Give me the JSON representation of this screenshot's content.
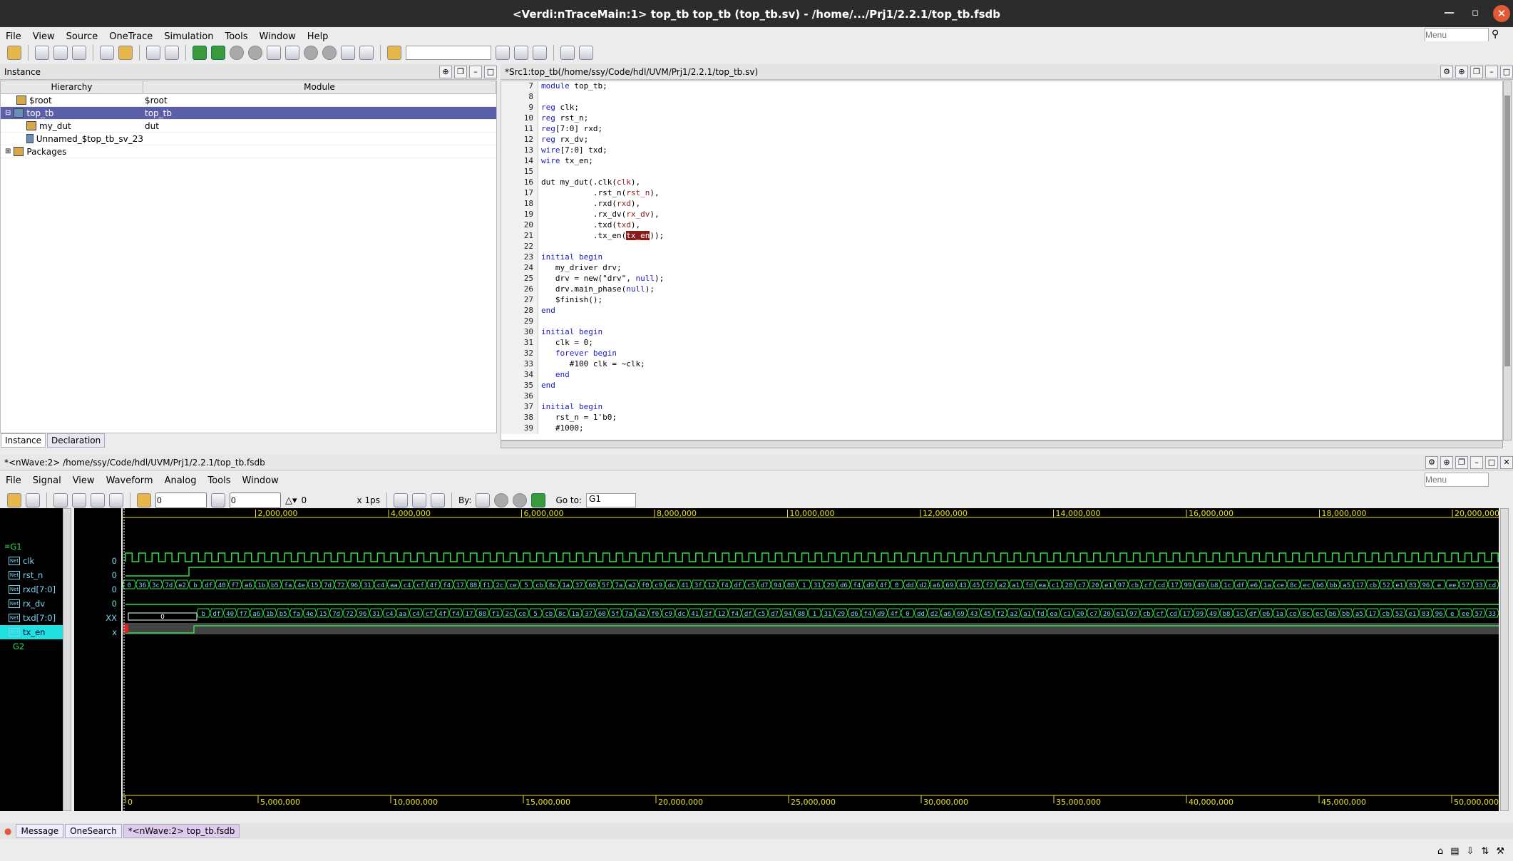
{
  "window": {
    "title": "<Verdi:nTraceMain:1> top_tb top_tb (top_tb.sv) - /home/.../Prj1/2.2.1/top_tb.fsdb"
  },
  "menu": [
    "File",
    "View",
    "Source",
    "OneTrace",
    "Simulation",
    "Tools",
    "Window",
    "Help"
  ],
  "menu_search_placeholder": "Menu",
  "instance_panel": {
    "title": "Instance",
    "col_hier": "Hierarchy",
    "col_module": "Module",
    "rows": [
      {
        "name": "$root",
        "module": "$root"
      },
      {
        "name": "top_tb",
        "module": "top_tb"
      },
      {
        "name": "my_dut",
        "module": "dut"
      },
      {
        "name": "Unnamed_$top_tb_sv_23",
        "module": ""
      },
      {
        "name": "Packages",
        "module": ""
      }
    ],
    "tabs": [
      "Instance",
      "Declaration"
    ]
  },
  "source": {
    "title": "*Src1:top_tb(/home/ssy/Code/hdl/UVM/Prj1/2.2.1/top_tb.sv)",
    "lines": [
      [
        "7",
        "module top_tb;"
      ],
      [
        "8",
        ""
      ],
      [
        "9",
        "reg clk;"
      ],
      [
        "10",
        "reg rst_n;"
      ],
      [
        "11",
        "reg[7:0] rxd;"
      ],
      [
        "12",
        "reg rx_dv;"
      ],
      [
        "13",
        "wire[7:0] txd;"
      ],
      [
        "14",
        "wire tx_en;"
      ],
      [
        "15",
        ""
      ],
      [
        "16",
        "dut my_dut(.clk(clk),"
      ],
      [
        "17",
        "           .rst_n(rst_n),"
      ],
      [
        "18",
        "           .rxd(rxd),"
      ],
      [
        "19",
        "           .rx_dv(rx_dv),"
      ],
      [
        "20",
        "           .txd(txd),"
      ],
      [
        "21",
        "           .tx_en(tx_en));"
      ],
      [
        "22",
        ""
      ],
      [
        "23",
        "initial begin"
      ],
      [
        "24",
        "   my_driver drv;"
      ],
      [
        "25",
        "   drv = new(\"drv\", null);"
      ],
      [
        "26",
        "   drv.main_phase(null);"
      ],
      [
        "27",
        "   $finish();"
      ],
      [
        "28",
        "end"
      ],
      [
        "29",
        ""
      ],
      [
        "30",
        "initial begin"
      ],
      [
        "31",
        "   clk = 0;"
      ],
      [
        "32",
        "   forever begin"
      ],
      [
        "33",
        "      #100 clk = ~clk;"
      ],
      [
        "34",
        "   end"
      ],
      [
        "35",
        "end"
      ],
      [
        "36",
        ""
      ],
      [
        "37",
        "initial begin"
      ],
      [
        "38",
        "   rst_n = 1'b0;"
      ],
      [
        "39",
        "   #1000;"
      ]
    ]
  },
  "wave": {
    "title": "*<nWave:2> /home/ssy/Code/hdl/UVM/Prj1/2.2.1/top_tb.fsdb",
    "menu": [
      "File",
      "Signal",
      "View",
      "Waveform",
      "Analog",
      "Tools",
      "Window"
    ],
    "cursor": "0",
    "marker": "0",
    "delta": "0",
    "unit": "x 1ps",
    "by_label": "By:",
    "goto_label": "Go to:",
    "goto_value": "G1",
    "top_ticks": [
      "2,000,000",
      "4,000,000",
      "6,000,000",
      "8,000,000",
      "10,000,000",
      "12,000,000",
      "14,000,000",
      "16,000,000",
      "18,000,000",
      "20,000,000"
    ],
    "bottom_ticks": [
      "0",
      "5,000,000",
      "10,000,000",
      "15,000,000",
      "20,000,000",
      "25,000,000",
      "30,000,000",
      "35,000,000",
      "40,000,000",
      "45,000,000",
      "50,000,000"
    ],
    "groups": [
      "G1",
      "G2"
    ],
    "signals": [
      {
        "name": "clk",
        "value": "0"
      },
      {
        "name": "rst_n",
        "value": "0"
      },
      {
        "name": "rxd[7:0]",
        "value": "0"
      },
      {
        "name": "rx_dv",
        "value": "0"
      },
      {
        "name": "txd[7:0]",
        "value": "XX"
      },
      {
        "name": "tx_en",
        "value": "x"
      }
    ],
    "rxd_values": [
      "0",
      "36",
      "3c",
      "7d",
      "e2",
      "b",
      "df",
      "40",
      "f7",
      "a6",
      "1b",
      "b5",
      "fa",
      "4e",
      "15",
      "7d",
      "72",
      "96",
      "31",
      "c4",
      "aa",
      "c4",
      "cf",
      "4f",
      "f4",
      "17",
      "88",
      "f1",
      "2c",
      "ce",
      "5",
      "cb",
      "8c",
      "1a",
      "37",
      "60",
      "5f",
      "7a",
      "a2",
      "f0",
      "c9",
      "dc",
      "41",
      "3f",
      "12",
      "f4",
      "df",
      "c5",
      "d7",
      "94",
      "88",
      "1",
      "31",
      "29",
      "d6",
      "f4",
      "d9",
      "4f",
      "0",
      "dd",
      "d2",
      "a6",
      "69",
      "43",
      "45",
      "f2",
      "a2",
      "a1",
      "fd",
      "ea",
      "c1",
      "20",
      "c7",
      "20",
      "e1",
      "97",
      "cb",
      "cf",
      "cd",
      "17",
      "99",
      "49",
      "b8",
      "1c",
      "df",
      "e6",
      "1a",
      "ce",
      "8c",
      "ec",
      "b6",
      "bb",
      "a5",
      "17",
      "cb",
      "52",
      "e1",
      "83",
      "96",
      "e",
      "ee",
      "57",
      "33",
      "cd"
    ],
    "txd_values": [
      "0",
      "b",
      "df",
      "40",
      "f7",
      "a6",
      "1b",
      "b5",
      "fa",
      "4e",
      "15",
      "7d",
      "72",
      "96",
      "31",
      "c4",
      "aa",
      "c4",
      "cf",
      "4f",
      "f4",
      "17",
      "88",
      "f1",
      "2c",
      "ce",
      "5",
      "cb",
      "8c",
      "1a",
      "37",
      "60",
      "5f",
      "7a",
      "a2",
      "f0",
      "c9",
      "dc",
      "41",
      "3f",
      "12",
      "f4",
      "df",
      "c5",
      "d7",
      "94",
      "88",
      "1",
      "31",
      "29",
      "d6",
      "f4",
      "d9",
      "4f",
      "0",
      "dd",
      "d2",
      "a6",
      "69",
      "43",
      "45",
      "f2",
      "a2",
      "a1",
      "fd",
      "ea",
      "c1",
      "20",
      "c7",
      "20",
      "e1",
      "97",
      "cb",
      "cf",
      "cd",
      "17",
      "99",
      "49",
      "b8",
      "1c",
      "df",
      "e6",
      "1a",
      "ce",
      "8c",
      "ec",
      "b6",
      "bb",
      "a5",
      "17",
      "cb",
      "52",
      "e1",
      "83",
      "96",
      "e",
      "ee",
      "57",
      "33"
    ]
  },
  "bottom_tabs": [
    "Message",
    "OneSearch",
    "*<nWave:2> top_tb.fsdb"
  ]
}
